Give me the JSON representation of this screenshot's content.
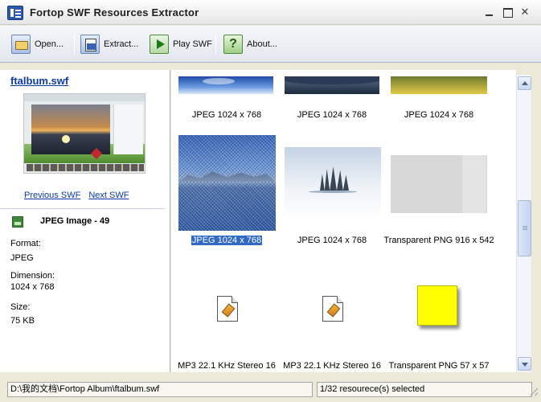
{
  "window": {
    "title": "Fortop SWF Resources Extractor"
  },
  "toolbar": {
    "open_label": "Open...",
    "extract_label": "Extract...",
    "play_label": "Play SWF",
    "about_label": "About..."
  },
  "left": {
    "swf_name": "ftalbum.swf",
    "previous_label": "Previous SWF",
    "next_label": "Next SWF",
    "item_title": "JPEG Image - 49",
    "format_label": "Format:",
    "format_value": "JPEG",
    "dimension_label": "Dimension:",
    "dimension_value": "1024 x 768",
    "size_label": "Size:",
    "size_value": "75 KB"
  },
  "grid": {
    "items": [
      {
        "caption": "JPEG 1024 x 768",
        "kind": "water"
      },
      {
        "caption": "JPEG 1024 x 768",
        "kind": "rock"
      },
      {
        "caption": "JPEG 1024 x 768",
        "kind": "field"
      },
      {
        "caption": "JPEG 1024 x 768",
        "kind": "lake",
        "selected": true
      },
      {
        "caption": "JPEG 1024 x 768",
        "kind": "snow"
      },
      {
        "caption": "Transparent PNG 916 x 542",
        "kind": "png"
      },
      {
        "caption": "MP3 22.1 KHz Stereo 16",
        "kind": "mp3-file-icon"
      },
      {
        "caption": "MP3 22.1 KHz Stereo 16",
        "kind": "mp3-file-icon"
      },
      {
        "caption": "Transparent PNG 57 x 57",
        "kind": "yellow-square",
        "color": "#ffff00"
      }
    ]
  },
  "status": {
    "path": "D:\\我的文档\\Fortop Album\\ftalbum.swf",
    "selection": "1/32 resourece(s) selected"
  },
  "colors": {
    "link": "#0b3aa6",
    "selection": "#316ac5"
  }
}
